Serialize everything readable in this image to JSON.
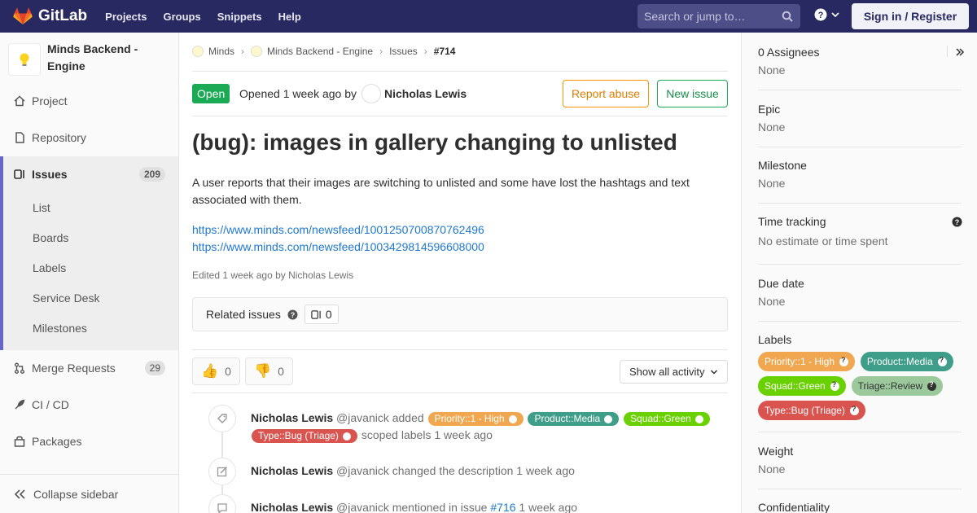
{
  "topnav": {
    "logo_text": "GitLab",
    "links": [
      "Projects",
      "Groups",
      "Snippets",
      "Help"
    ],
    "search_placeholder": "Search or jump to…",
    "signin_label": "Sign in / Register"
  },
  "sidebar": {
    "project_name": "Minds Backend - Engine",
    "items": [
      {
        "label": "Project",
        "icon": "home-icon"
      },
      {
        "label": "Repository",
        "icon": "doc-icon"
      },
      {
        "label": "Issues",
        "icon": "issues-icon",
        "count": "209"
      },
      {
        "label": "Merge Requests",
        "icon": "merge-icon",
        "count": "29"
      },
      {
        "label": "CI / CD",
        "icon": "rocket-icon"
      },
      {
        "label": "Packages",
        "icon": "package-icon"
      }
    ],
    "sub_items": [
      "List",
      "Boards",
      "Labels",
      "Service Desk",
      "Milestones"
    ],
    "collapse_label": "Collapse sidebar"
  },
  "breadcrumb": {
    "items": [
      "Minds",
      "Minds Backend - Engine",
      "Issues"
    ],
    "current": "#714"
  },
  "issue": {
    "status": "Open",
    "opened_text": "Opened 1 week ago by",
    "author": "Nicholas Lewis",
    "report_label": "Report abuse",
    "new_label": "New issue",
    "title": "(bug): images in gallery changing to unlisted",
    "description": "A user reports that their images are switching to unlisted and some have lost the hashtags and text associated with them.",
    "links": [
      "https://www.minds.com/newsfeed/1001250700870762496",
      "https://www.minds.com/newsfeed/1003429814596608000"
    ],
    "edited": "Edited 1 week ago by Nicholas Lewis",
    "related_label": "Related issues",
    "related_count": "0",
    "thumbs_up": "0",
    "thumbs_down": "0",
    "show_activity": "Show all activity"
  },
  "timeline": [
    {
      "author": "Nicholas Lewis",
      "handle": "@javanick",
      "action": "added",
      "labels": [
        {
          "text": "Priority::1 - High",
          "color": "#f0a74f"
        },
        {
          "text": "Product::Media",
          "color": "#3f9e89"
        },
        {
          "text": "Squad::Green",
          "color": "#69d100"
        },
        {
          "text": "Type::Bug (Triage)",
          "color": "#d9534f"
        }
      ],
      "suffix": "scoped labels",
      "time": "1 week ago"
    },
    {
      "author": "Nicholas Lewis",
      "handle": "@javanick",
      "action": "changed the description",
      "time": "1 week ago"
    },
    {
      "author": "Nicholas Lewis",
      "handle": "@javanick",
      "action": "mentioned in issue",
      "ref": "#716",
      "time": "1 week ago"
    }
  ],
  "right_sidebar": {
    "assignees_title": "0 Assignees",
    "assignees_value": "None",
    "epic_title": "Epic",
    "epic_value": "None",
    "milestone_title": "Milestone",
    "milestone_value": "None",
    "time_title": "Time tracking",
    "time_value": "No estimate or time spent",
    "due_title": "Due date",
    "due_value": "None",
    "labels_title": "Labels",
    "labels": [
      {
        "text": "Priority::1 - High",
        "color": "#f0a74f"
      },
      {
        "text": "Product::Media",
        "color": "#3f9e89"
      },
      {
        "text": "Squad::Green",
        "color": "#69d100"
      },
      {
        "text": "Triage::Review",
        "color": "#9bc99b"
      },
      {
        "text": "Type::Bug (Triage)",
        "color": "#d9534f"
      }
    ],
    "weight_title": "Weight",
    "weight_value": "None",
    "confidentiality_title": "Confidentiality"
  }
}
